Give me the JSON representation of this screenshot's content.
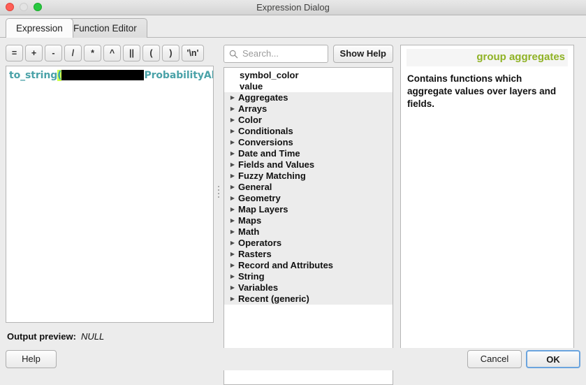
{
  "window": {
    "title": "Expression Dialog",
    "controls": {
      "close": "close-button",
      "minimize": "minimize-button",
      "zoom": "zoom-button"
    }
  },
  "tabs": [
    {
      "label": "Expression",
      "active": true
    },
    {
      "label": "Function Editor",
      "active": false
    }
  ],
  "operator_buttons": [
    {
      "label": "="
    },
    {
      "label": "+"
    },
    {
      "label": "-"
    },
    {
      "label": "/"
    },
    {
      "label": "*"
    },
    {
      "label": "^"
    },
    {
      "label": "||"
    },
    {
      "label": "("
    },
    {
      "label": ")"
    },
    {
      "label": "'\\n'"
    }
  ],
  "expression": {
    "function_name": "to_string",
    "open_paren": "(",
    "redacted": "",
    "field_name": "ProbabilityAbove",
    "close_paren": ")"
  },
  "output_preview": {
    "label": "Output preview:",
    "value": "NULL"
  },
  "search": {
    "placeholder": "Search...",
    "value": "",
    "icon": "search-icon"
  },
  "show_help_button": {
    "label": "Show Help"
  },
  "function_tree": [
    {
      "label": "symbol_color",
      "type": "leaf",
      "expandable": false
    },
    {
      "label": "value",
      "type": "leaf",
      "expandable": false
    },
    {
      "label": "Aggregates",
      "type": "group",
      "expandable": true
    },
    {
      "label": "Arrays",
      "type": "group",
      "expandable": true
    },
    {
      "label": "Color",
      "type": "group",
      "expandable": true
    },
    {
      "label": "Conditionals",
      "type": "group",
      "expandable": true
    },
    {
      "label": "Conversions",
      "type": "group",
      "expandable": true
    },
    {
      "label": "Date and Time",
      "type": "group",
      "expandable": true
    },
    {
      "label": "Fields and Values",
      "type": "group",
      "expandable": true
    },
    {
      "label": "Fuzzy Matching",
      "type": "group",
      "expandable": true
    },
    {
      "label": "General",
      "type": "group",
      "expandable": true
    },
    {
      "label": "Geometry",
      "type": "group",
      "expandable": true
    },
    {
      "label": "Map Layers",
      "type": "group",
      "expandable": true
    },
    {
      "label": "Maps",
      "type": "group",
      "expandable": true
    },
    {
      "label": "Math",
      "type": "group",
      "expandable": true
    },
    {
      "label": "Operators",
      "type": "group",
      "expandable": true
    },
    {
      "label": "Rasters",
      "type": "group",
      "expandable": true
    },
    {
      "label": "Record and Attributes",
      "type": "group",
      "expandable": true
    },
    {
      "label": "String",
      "type": "group",
      "expandable": true
    },
    {
      "label": "Variables",
      "type": "group",
      "expandable": true
    },
    {
      "label": "Recent (generic)",
      "type": "group",
      "expandable": true
    }
  ],
  "help_panel": {
    "title": "group aggregates",
    "body": "Contains functions which aggregate values over layers and fields."
  },
  "dialog_buttons": {
    "help": "Help",
    "cancel": "Cancel",
    "ok": "OK"
  },
  "colors": {
    "help_title": "#8fb225",
    "expression_function": "#4aa2a8",
    "paren_highlight": "#ccff4d",
    "ok_focus_ring": "#6ba4de",
    "window_chrome": "#ececec"
  }
}
